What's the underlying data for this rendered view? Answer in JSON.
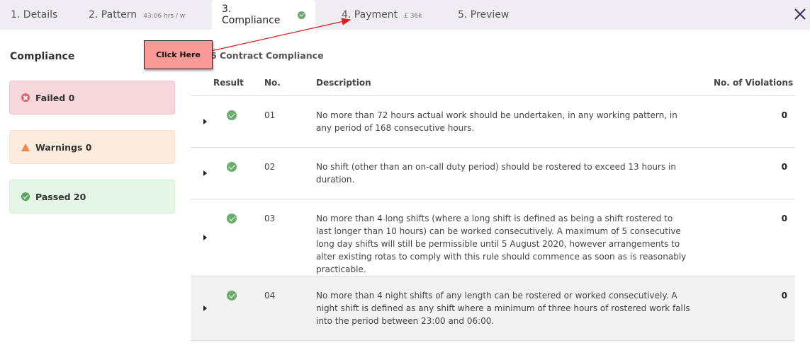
{
  "tabs": [
    {
      "label": "1. Details",
      "sub": ""
    },
    {
      "label": "2. Pattern",
      "sub": "43:06 hrs / w"
    },
    {
      "label": "3. Compliance",
      "sub": ""
    },
    {
      "label": "4. Payment",
      "sub": "£ 36k"
    },
    {
      "label": "5. Preview",
      "sub": ""
    }
  ],
  "sidebar": {
    "title": "Compliance",
    "failed": "Failed 0",
    "warnings": "Warnings 0",
    "passed": "Passed 20"
  },
  "callout": {
    "label": "Click Here"
  },
  "main": {
    "section_title": "6 Contract Compliance",
    "columns": {
      "result": "Result",
      "no": "No.",
      "description": "Description",
      "violations": "No. of Violations"
    },
    "rows": [
      {
        "no": "01",
        "description": "No more than 72 hours actual work should be undertaken, in any working pattern, in any period of 168 consecutive hours.",
        "violations": "0"
      },
      {
        "no": "02",
        "description": "No shift (other than an on-call duty period) should be rostered to exceed 13 hours in duration.",
        "violations": "0"
      },
      {
        "no": "03",
        "description": "No more than 4 long shifts (where a long shift is defined as being a shift rostered to last longer than 10 hours) can be worked consecutively. A maximum of 5 consecutive long day shifts will still be permissible until 5 August 2020, however arrangements to alter existing rotas to comply with this rule should commence as soon as is reasonably practicable.",
        "violations": "0"
      },
      {
        "no": "04",
        "description": "No more than 4 night shifts of any length can be rostered or worked consecutively. A night shift is defined as any shift where a minimum of three hours of rostered work falls into the period between 23:00 and 06:00.",
        "violations": "0"
      }
    ]
  }
}
